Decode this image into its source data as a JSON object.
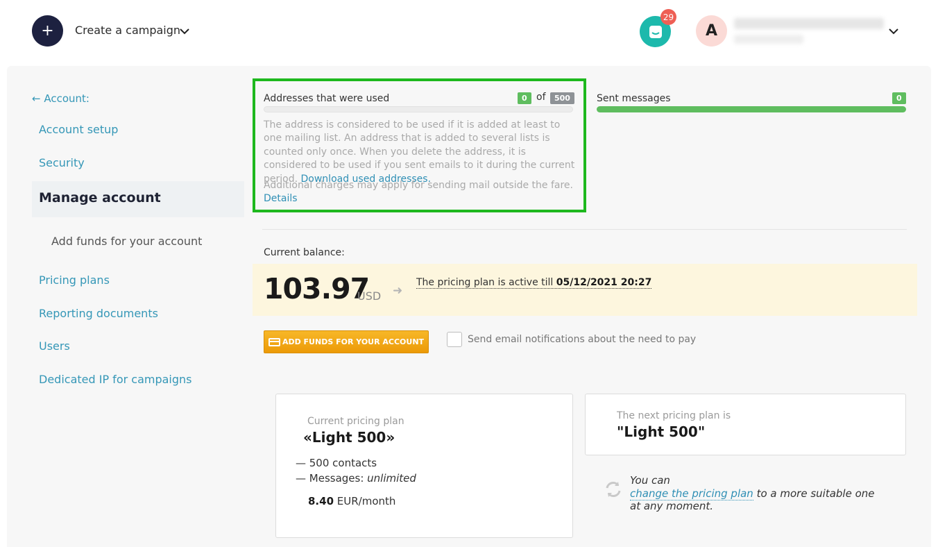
{
  "header": {
    "create_label": "Create a campaign",
    "chat_count": "29",
    "avatar_letter": "A"
  },
  "sidebar": {
    "back_label": "← Account:",
    "items": [
      {
        "label": "Account setup"
      },
      {
        "label": "Security"
      },
      {
        "label": "Manage account"
      },
      {
        "label": "Add funds for your account"
      },
      {
        "label": "Pricing plans"
      },
      {
        "label": "Reporting documents"
      },
      {
        "label": "Users"
      },
      {
        "label": "Dedicated IP for campaigns"
      }
    ]
  },
  "usage": {
    "addresses_label": "Addresses that were used",
    "addresses_used": "0",
    "of_label": "of",
    "addresses_limit": "500",
    "addresses_fraction": 0,
    "help_text": "The address is considered to be used if it is added at least to one mailing list. An address that is added to several lists is counted only once. When you delete the address, it is considered to be used if you sent emails to it during the current period.",
    "download_link": "Download used addresses.",
    "charges_text": "Additional charges may apply for sending mail outside the fare.",
    "details_link": "Details",
    "sent_label": "Sent messages",
    "sent_count": "0"
  },
  "balance": {
    "label": "Current balance:",
    "amount": "103.97",
    "currency": "USD",
    "plan_active_text": "The pricing plan is active till",
    "plan_active_date": "05/12/2021 20:27",
    "add_funds_button": "ADD FUNDS FOR YOUR ACCOUNT",
    "notify_label": "Send email notifications about the need to pay"
  },
  "current_plan": {
    "label": "Current pricing plan",
    "name": "«Light 500»",
    "contacts": "— 500 contacts",
    "messages_label": "— Messages:",
    "messages_value": "unlimited",
    "price": "8.40",
    "price_unit": "EUR/month"
  },
  "next_plan": {
    "label": "The next pricing plan is",
    "name": "\"Light 500\"",
    "change_prefix": "You can",
    "change_link": "change the pricing plan",
    "change_suffix": "to a more suitable one at any moment."
  },
  "colors": {
    "accent": "#3597b7",
    "highlight": "#1eb81e",
    "button": "#f2a512",
    "balance_bg": "#fdf6de"
  }
}
